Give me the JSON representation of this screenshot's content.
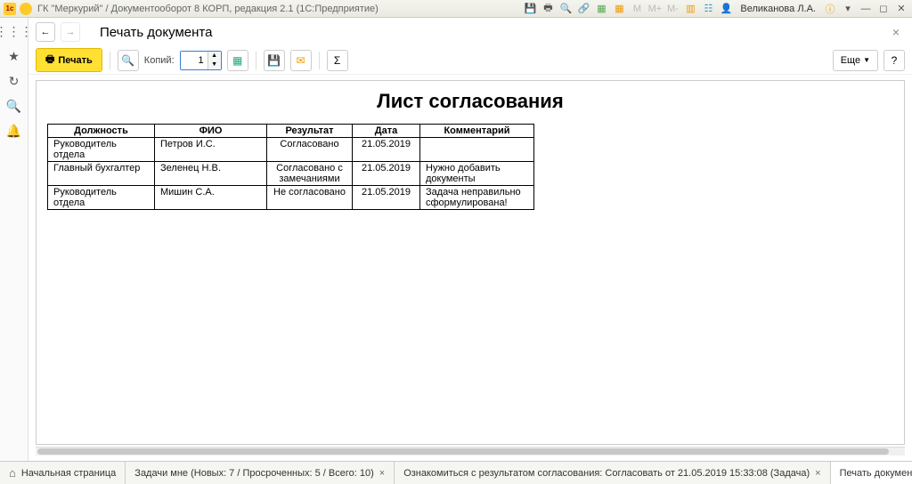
{
  "titlebar": {
    "title": "ГК \"Меркурий\" / Документооборот 8 КОРП, редакция 2.1  (1С:Предприятие)",
    "user": "Великанова Л.А."
  },
  "page": {
    "title": "Печать документа"
  },
  "toolbar": {
    "print": "Печать",
    "copies_label": "Копий:",
    "copies_value": "1",
    "more": "Еще",
    "help": "?"
  },
  "doc": {
    "title": "Лист согласования",
    "headers": {
      "pos": "Должность",
      "fio": "ФИО",
      "res": "Результат",
      "date": "Дата",
      "com": "Комментарий"
    },
    "rows": [
      {
        "pos": "Руководитель отдела",
        "fio": "Петров И.С.",
        "res": "Согласовано",
        "date": "21.05.2019",
        "com": ""
      },
      {
        "pos": "Главный бухгалтер",
        "fio": "Зеленец Н.В.",
        "res": "Согласовано с замечаниями",
        "date": "21.05.2019",
        "com": "Нужно добавить документы"
      },
      {
        "pos": "Руководитель отдела",
        "fio": "Мишин С.А.",
        "res": "Не согласовано",
        "date": "21.05.2019",
        "com": "Задача неправильно сформулирована!"
      }
    ]
  },
  "tabs": {
    "home": "Начальная страница",
    "t1": "Задачи мне (Новых: 7 / Просроченных: 5 / Всего: 10)",
    "t2": "Ознакомиться с результатом согласования: Согласовать от 21.05.2019 15:33:08 (Задача)",
    "t3": "Печать документа"
  }
}
